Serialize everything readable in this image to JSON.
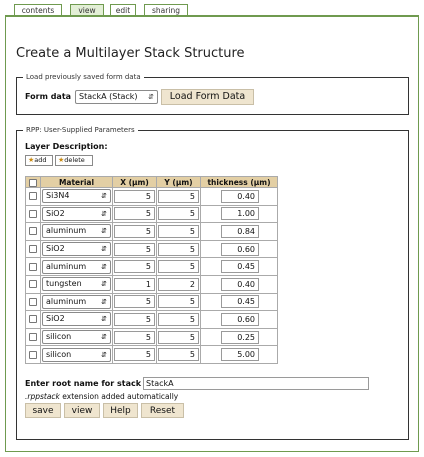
{
  "tabs": [
    {
      "label": "contents",
      "active": false
    },
    {
      "label": "view",
      "active": true
    },
    {
      "label": "edit",
      "active": false
    },
    {
      "label": "sharing",
      "active": false
    }
  ],
  "page_title": "Create a Multilayer Stack Structure",
  "load_section": {
    "legend": "Load previously saved form data",
    "form_data_label": "Form data",
    "selected": "StackA (Stack)",
    "load_button": "Load Form Data"
  },
  "rpp_section": {
    "legend": "RPP: User-Supplied Parameters",
    "layer_desc_label": "Layer Description:",
    "add_label": "add",
    "delete_label": "delete",
    "columns": {
      "material": "Material",
      "x": "X (µm)",
      "y": "Y (µm)",
      "thickness": "thickness (µm)"
    },
    "rows": [
      {
        "material": "Si3N4",
        "x": "5",
        "y": "5",
        "thickness": "0.40"
      },
      {
        "material": "SiO2",
        "x": "5",
        "y": "5",
        "thickness": "1.00"
      },
      {
        "material": "aluminum",
        "x": "5",
        "y": "5",
        "thickness": "0.84"
      },
      {
        "material": "SiO2",
        "x": "5",
        "y": "5",
        "thickness": "0.60"
      },
      {
        "material": "aluminum",
        "x": "5",
        "y": "5",
        "thickness": "0.45"
      },
      {
        "material": "tungsten",
        "x": "1",
        "y": "2",
        "thickness": "0.40"
      },
      {
        "material": "aluminum",
        "x": "5",
        "y": "5",
        "thickness": "0.45"
      },
      {
        "material": "SiO2",
        "x": "5",
        "y": "5",
        "thickness": "0.60"
      },
      {
        "material": "silicon",
        "x": "5",
        "y": "5",
        "thickness": "0.25"
      },
      {
        "material": "silicon",
        "x": "5",
        "y": "5",
        "thickness": "5.00"
      }
    ],
    "root_name_label": "Enter root name for stack",
    "root_name_value": "StackA",
    "extension_ext": ".rppstack",
    "extension_note": " extension added automatically",
    "buttons": {
      "save": "save",
      "view": "view",
      "help": "Help",
      "reset": "Reset"
    }
  },
  "colors": {
    "tab_border": "#6f9a4f",
    "header_bg": "#e3cfa4",
    "button_bg": "#efe5cf"
  }
}
